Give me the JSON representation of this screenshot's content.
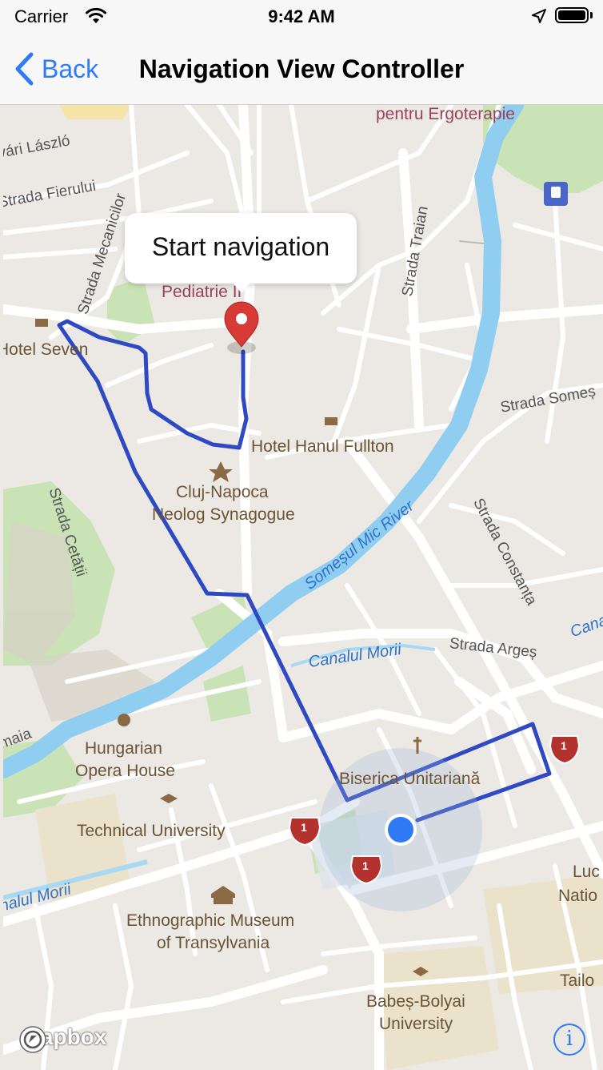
{
  "status_bar": {
    "carrier": "Carrier",
    "time": "9:42 AM"
  },
  "nav_bar": {
    "back_label": "Back",
    "title": "Navigation View Controller"
  },
  "callout": {
    "text": "Start navigation"
  },
  "map_labels": {
    "pentru_ergoterapie": "pentru Ergoterapie",
    "vari_laszlo": "vári László",
    "strada_fierului": "Strada Fierului",
    "strada_mecanicilor": "Strada Mecanicilor",
    "strada_traian": "Strada Traian",
    "pediatrie": "Pediatrie II",
    "hotel_seven": "Hotel Seven",
    "hotel_hanul": "Hotel Hanul Fullton",
    "synagogue_line1": "Cluj-Napoca",
    "synagogue_line2": "Neolog Synagogue",
    "strada_somes": "Strada Someș",
    "strada_cetatii": "Strada Cetății",
    "somesul_mic": "Someșul Mic River",
    "strada_constanta": "Strada Constanța",
    "canalul_morii_center": "Canalul Morii",
    "strada_arges": "Strada Argeș",
    "canal_right": "Cana",
    "maia": "maia",
    "opera_line1": "Hungarian",
    "opera_line2": "Opera House",
    "biserica": "Biserica Unitariană",
    "technical_university": "Technical University",
    "canalul_morii_left": "nalul Morii",
    "ethno_line1": "Ethnographic Museum",
    "ethno_line2": "of Transylvania",
    "lucr": "Luc",
    "natio": "Natio",
    "tailo": "Tailo",
    "bbu_line1": "Babeș-Bolyai",
    "bbu_line2": "University",
    "route_shield": "1"
  },
  "attribution": {
    "logo_text": "mapbox",
    "info_symbol": "i"
  },
  "colors": {
    "route": "#2f48c4",
    "water": "#8ccdf2",
    "park": "#c8e6b4",
    "user_location": "#2f7bf5",
    "tint": "#2f7bf5",
    "shield": "#c0392b"
  }
}
